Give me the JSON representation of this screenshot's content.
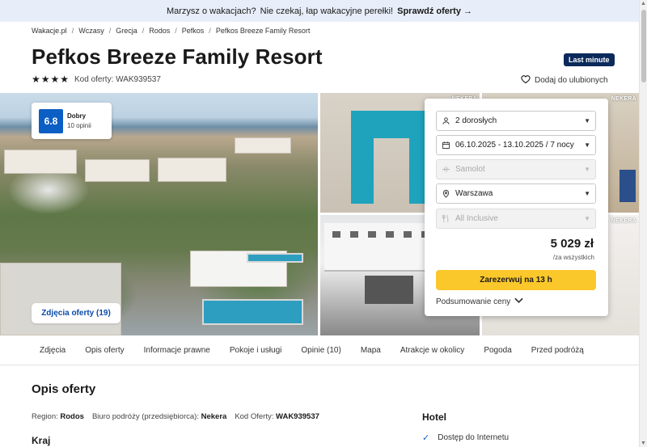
{
  "promo": {
    "text": "Marzysz o wakacjach?",
    "text2": "Nie czekaj, łap wakacyjne perełki!",
    "cta": "Sprawdź oferty →"
  },
  "breadcrumbs": [
    "Wakacje.pl",
    "Wczasy",
    "Grecja",
    "Rodos",
    "Pefkos",
    "Pefkos Breeze Family Resort"
  ],
  "hotel": {
    "name": "Pefkos Breeze Family Resort",
    "badge": "Last minute",
    "stars": "★★★★",
    "star_count": 4,
    "offer_code_label": "Kod oferty: WAK939537",
    "favorite_label": "Dodaj do ulubionych"
  },
  "rating": {
    "score": "6.8",
    "label": "Dobry",
    "reviews": "10 opinii"
  },
  "gallery": {
    "photos_button": "Zdjęcia oferty (19)",
    "operator_tag": "NEKERA"
  },
  "booking": {
    "guests": "2 dorosłych",
    "dates": "06.10.2025 - 13.10.2025 / 7 nocy",
    "transport": "Samolot",
    "departure": "Warszawa",
    "board": "All Inclusive",
    "price": "5 029 zł",
    "price_note": "/za wszystkich",
    "reserve_button": "Zarezerwuj na 13 h",
    "summary_label": "Podsumowanie ceny"
  },
  "tabs": [
    "Zdjęcia",
    "Opis oferty",
    "Informacje prawne",
    "Pokoje i usługi",
    "Opinie (10)",
    "Mapa",
    "Atrakcje w okolicy",
    "Pogoda",
    "Przed podróżą"
  ],
  "description": {
    "heading": "Opis oferty",
    "region_label": "Region:",
    "region_value": "Rodos",
    "operator_label": "Biuro podróży (przedsiębiorca):",
    "operator_value": "Nekera",
    "code_label": "Kod Oferty:",
    "code_value": "WAK939537",
    "country_heading": "Kraj",
    "hotel_heading": "Hotel",
    "amenity_1": "Dostęp do Internetu"
  },
  "colors": {
    "accent": "#0b5ec3",
    "cta": "#fbc82c",
    "badge": "#0b2a5b",
    "promo_bg": "#e8eef9"
  }
}
